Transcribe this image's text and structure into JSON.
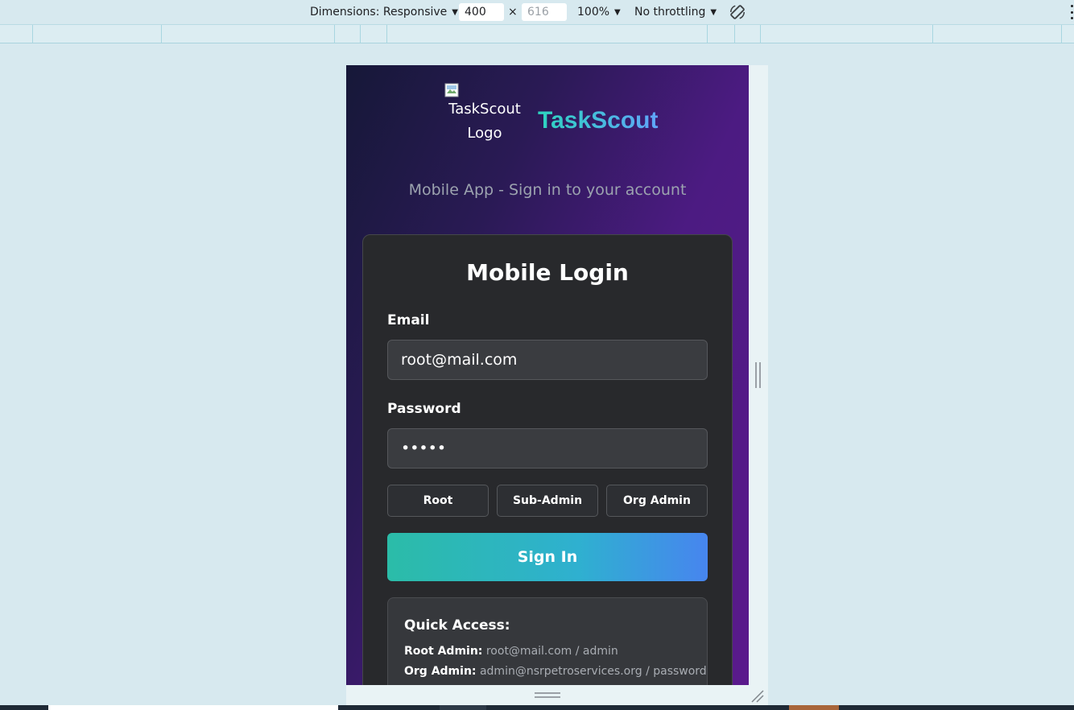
{
  "devtools": {
    "dimensions_label": "Dimensions: Responsive",
    "width_value": "400",
    "times": "×",
    "height_placeholder": "616",
    "zoom": "100%",
    "throttling": "No throttling",
    "icons": [
      "chevron-down-icon",
      "rotate-icon",
      "more-vertical-icon"
    ]
  },
  "app": {
    "logo_alt": "TaskScout Logo",
    "brand_name": "TaskScout",
    "subtitle": "Mobile App - Sign in to your account",
    "login": {
      "title": "Mobile Login",
      "email_label": "Email",
      "email_value": "root@mail.com",
      "password_label": "Password",
      "password_value": "•••••",
      "roles": [
        "Root",
        "Sub-Admin",
        "Org Admin"
      ],
      "signin_label": "Sign In"
    },
    "quick_access": {
      "title": "Quick Access:",
      "rows": [
        {
          "label": "Root Admin:",
          "value": "root@mail.com / admin"
        },
        {
          "label": "Org Admin:",
          "value": "admin@nsrpetroservices.org / password"
        }
      ]
    },
    "colors": {
      "brand_gradient_start": "#2dd4bf",
      "brand_gradient_end": "#60a5fa",
      "card_bg": "#28292c"
    }
  }
}
